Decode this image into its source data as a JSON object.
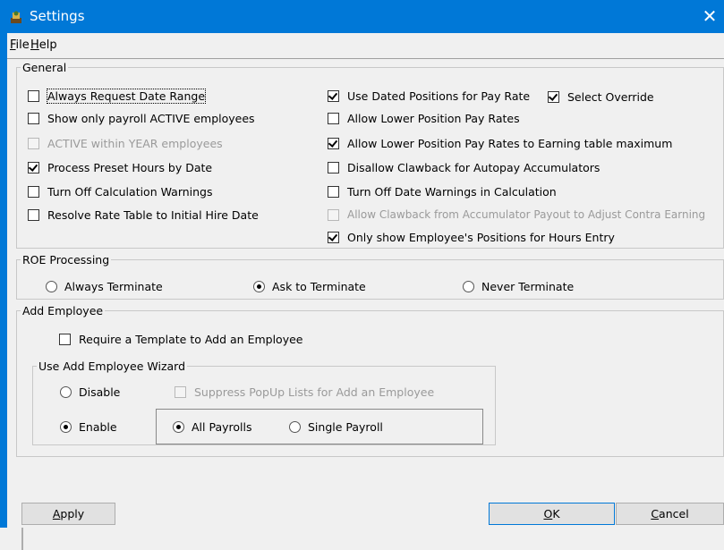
{
  "window": {
    "title": "Settings",
    "close_glyph": "✕",
    "icon": "app-icon"
  },
  "menu": [
    {
      "mnemonic": "F",
      "rest": "ile"
    },
    {
      "mnemonic": "H",
      "rest": "elp"
    }
  ],
  "general": {
    "legend": "General",
    "left": [
      {
        "label": "Always Request Date Range",
        "checked": false,
        "enabled": true
      },
      {
        "label": "Show only payroll ACTIVE employees",
        "checked": false,
        "enabled": true
      },
      {
        "label": "ACTIVE within YEAR employees",
        "checked": false,
        "enabled": false
      },
      {
        "label": "Process Preset Hours by Date",
        "checked": true,
        "enabled": true
      },
      {
        "label": "Turn Off Calculation Warnings",
        "checked": false,
        "enabled": true
      },
      {
        "label": "Resolve Rate Table to Initial Hire Date",
        "checked": false,
        "enabled": true
      }
    ],
    "right": [
      {
        "label": "Use Dated Positions for Pay Rate",
        "checked": true,
        "enabled": true
      },
      {
        "label": "Allow Lower Position Pay Rates",
        "checked": false,
        "enabled": true
      },
      {
        "label": "Allow Lower Position Pay Rates to Earning table maximum",
        "checked": true,
        "enabled": true
      },
      {
        "label": "Disallow Clawback for Autopay Accumulators",
        "checked": false,
        "enabled": true
      },
      {
        "label": "Turn Off Date Warnings in Calculation",
        "checked": false,
        "enabled": true
      },
      {
        "label": "Allow Clawback from Accumulator Payout to Adjust Contra Earning",
        "checked": false,
        "enabled": false
      },
      {
        "label": "Only show Employee's Positions for Hours Entry",
        "checked": true,
        "enabled": true
      }
    ],
    "select_override": {
      "label": "Select Override",
      "checked": true
    }
  },
  "roe": {
    "legend": "ROE Processing",
    "options": [
      {
        "label": "Always Terminate",
        "selected": false
      },
      {
        "label": "Ask to Terminate",
        "selected": true
      },
      {
        "label": "Never Terminate",
        "selected": false
      }
    ]
  },
  "add_employee": {
    "legend": "Add Employee",
    "require_template": {
      "label": "Require a Template to Add an Employee",
      "checked": false
    },
    "wizard": {
      "legend": "Use Add Employee Wizard",
      "disable": {
        "label": "Disable",
        "selected": false
      },
      "enable": {
        "label": "Enable",
        "selected": true
      },
      "suppress": {
        "label": "Suppress PopUp Lists for Add an Employee",
        "checked": false,
        "enabled": false
      },
      "all_payrolls": {
        "label": "All Payrolls",
        "selected": true
      },
      "single_payroll": {
        "label": "Single Payroll",
        "selected": false
      }
    }
  },
  "buttons": {
    "apply": {
      "mnemonic": "A",
      "rest": "pply"
    },
    "ok": {
      "mnemonic": "O",
      "rest": "K"
    },
    "cancel": {
      "mnemonic": "C",
      "rest": "ancel"
    }
  }
}
